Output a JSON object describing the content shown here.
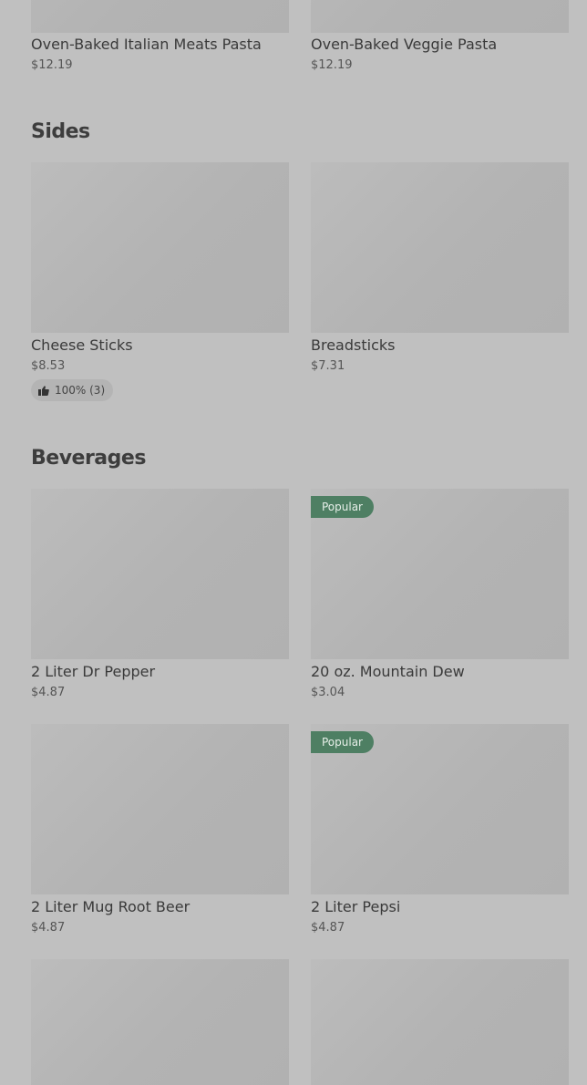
{
  "pasta": {
    "items": [
      {
        "name": "Oven-Baked Italian Meats Pasta",
        "price": "$12.19"
      },
      {
        "name": "Oven-Baked Veggie Pasta",
        "price": "$12.19"
      }
    ]
  },
  "sides": {
    "title": "Sides",
    "items": [
      {
        "name": "Cheese Sticks",
        "price": "$8.53",
        "rating": "100% (3)",
        "rating_icon": "thumbs-up-icon"
      },
      {
        "name": "Breadsticks",
        "price": "$7.31"
      }
    ]
  },
  "beverages": {
    "title": "Beverages",
    "items": [
      {
        "name": "2 Liter Dr Pepper",
        "price": "$4.87"
      },
      {
        "name": "20 oz. Mountain Dew",
        "price": "$3.04",
        "badge": "Popular"
      },
      {
        "name": "2 Liter Mug Root Beer",
        "price": "$4.87"
      },
      {
        "name": "2 Liter Pepsi",
        "price": "$4.87",
        "badge": "Popular"
      }
    ]
  },
  "colors": {
    "background": "#c0c0c0",
    "placeholder": "#b3b3b3",
    "badge": "#4e7f63",
    "text": "#3a3a3a"
  }
}
